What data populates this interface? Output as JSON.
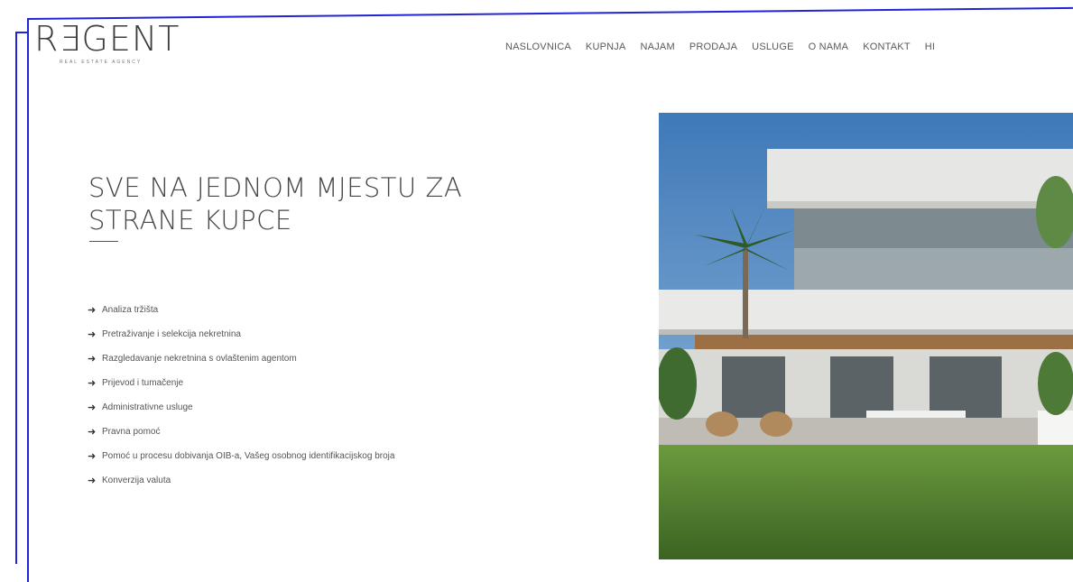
{
  "brand": {
    "name": "RƎGENT",
    "tagline": "REAL ESTATE AGENCY"
  },
  "nav": {
    "items": [
      "NASLOVNICA",
      "KUPNJA",
      "NAJAM",
      "PRODAJA",
      "USLUGE",
      "O NAMA",
      "KONTAKT",
      "HI"
    ]
  },
  "section": {
    "title": "SVE NA JEDNOM MJESTU ZA STRANE KUPCE",
    "features": [
      "Analiza tržišta",
      "Pretraživanje i selekcija nekretnina",
      "Razgledavanje nekretnina s ovlaštenim agentom",
      "Prijevod i tumačenje",
      "Administrativne usluge",
      "Pravna pomoć",
      "Pomoć u procesu dobivanja OIB-a, Vašeg osobnog identifikacijskog broja",
      "Konverzija valuta"
    ]
  },
  "colors": {
    "frame": "#2323d8",
    "text": "#474747",
    "sky": "#5f95c8",
    "grass": "#4f7d2f"
  },
  "icons": {
    "feature_bullet": "arrow-right-icon"
  }
}
